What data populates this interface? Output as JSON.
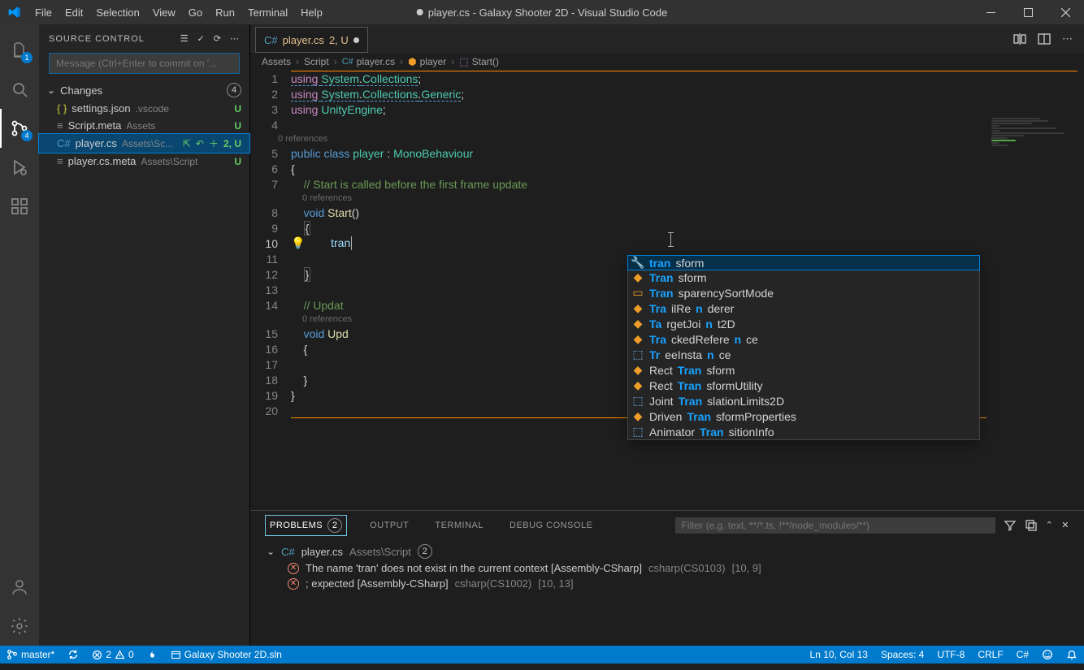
{
  "title": {
    "unsaved_dot": true,
    "filename": "player.cs",
    "project": "Galaxy Shooter 2D",
    "app": "Visual Studio Code"
  },
  "menu": [
    "File",
    "Edit",
    "Selection",
    "View",
    "Go",
    "Run",
    "Terminal",
    "Help"
  ],
  "activity_badges": {
    "explorer": "1",
    "scm": "4"
  },
  "source_control": {
    "title": "SOURCE CONTROL",
    "message_placeholder": "Message (Ctrl+Enter to commit on '...",
    "section": "Changes",
    "change_count": "4",
    "files": [
      {
        "name": "settings.json",
        "path": ".vscode",
        "status": "U",
        "icon": "json"
      },
      {
        "name": "Script.meta",
        "path": "Assets",
        "status": "U",
        "icon": "meta"
      },
      {
        "name": "player.cs",
        "path": "Assets\\Sc...",
        "status": "2, U",
        "icon": "cs",
        "selected": true,
        "row_actions": true
      },
      {
        "name": "player.cs.meta",
        "path": "Assets\\Script",
        "status": "U",
        "icon": "meta"
      }
    ]
  },
  "tab": {
    "filename": "player.cs",
    "suffix": "2, U",
    "dirty": true
  },
  "breadcrumb": [
    "Assets",
    "Script",
    "player.cs",
    "player",
    "Start()"
  ],
  "code": {
    "lines": [
      {
        "n": "1",
        "seg": [
          [
            "k-using dashed",
            "using "
          ],
          [
            "k-ns dashed",
            "System"
          ],
          [
            "dot dashed",
            "."
          ],
          [
            "k-ns dashed",
            "Collections"
          ],
          [
            "txt",
            ";"
          ]
        ]
      },
      {
        "n": "2",
        "seg": [
          [
            "k-using dashed",
            "using "
          ],
          [
            "k-ns dashed",
            "System"
          ],
          [
            "dot dashed",
            "."
          ],
          [
            "k-ns dashed",
            "Collections"
          ],
          [
            "dot dashed",
            "."
          ],
          [
            "k-ns dashed",
            "Generic"
          ],
          [
            "txt",
            ";"
          ]
        ]
      },
      {
        "n": "3",
        "seg": [
          [
            "k-using",
            "using "
          ],
          [
            "k-ns",
            "UnityEngine"
          ],
          [
            "txt",
            ";"
          ]
        ]
      },
      {
        "n": "4",
        "seg": []
      },
      {
        "ref": "0 references",
        "indent": 1
      },
      {
        "n": "5",
        "seg": [
          [
            "k-blue",
            "public "
          ],
          [
            "k-blue",
            "class "
          ],
          [
            "k-cls",
            "player"
          ],
          [
            "txt",
            " : "
          ],
          [
            "k-cls",
            "MonoBehaviour"
          ]
        ]
      },
      {
        "n": "6",
        "seg": [
          [
            "txt",
            "{"
          ]
        ]
      },
      {
        "n": "7",
        "seg": [
          [
            "txt",
            "    "
          ],
          [
            "cmt",
            "// Start is called before the first frame update"
          ]
        ]
      },
      {
        "ref": "0 references",
        "indent": 2
      },
      {
        "n": "8",
        "seg": [
          [
            "txt",
            "    "
          ],
          [
            "k-type",
            "void "
          ],
          [
            "k-fn",
            "Start"
          ],
          [
            "txt",
            "()"
          ]
        ]
      },
      {
        "n": "9",
        "seg": [
          [
            "txt",
            "    "
          ],
          [
            "txt box",
            "{"
          ]
        ]
      },
      {
        "n": "10",
        "active": true,
        "bulb": true,
        "seg": [
          [
            "txt",
            "        "
          ],
          [
            "caret-txt",
            "tran"
          ]
        ],
        "caret": true
      },
      {
        "n": "11",
        "seg": []
      },
      {
        "n": "12",
        "seg": [
          [
            "txt",
            "    "
          ],
          [
            "txt box",
            "}"
          ]
        ]
      },
      {
        "n": "13",
        "seg": []
      },
      {
        "n": "14",
        "seg": [
          [
            "txt",
            "    "
          ],
          [
            "cmt",
            "// Updat"
          ]
        ]
      },
      {
        "ref": "0 references",
        "indent": 2,
        "cut": true
      },
      {
        "n": "15",
        "seg": [
          [
            "txt",
            "    "
          ],
          [
            "k-type",
            "void "
          ],
          [
            "k-fn",
            "Upd"
          ]
        ]
      },
      {
        "n": "16",
        "seg": [
          [
            "txt",
            "    {"
          ]
        ]
      },
      {
        "n": "17",
        "seg": []
      },
      {
        "n": "18",
        "seg": [
          [
            "txt",
            "    }"
          ]
        ]
      },
      {
        "n": "19",
        "seg": [
          [
            "txt",
            "}"
          ]
        ]
      },
      {
        "n": "20",
        "seg": []
      }
    ]
  },
  "suggest": [
    {
      "icon": "wrench",
      "pre": "tran",
      "rest": "sform",
      "sel": true
    },
    {
      "icon": "class",
      "pre": "Tran",
      "rest": "sform"
    },
    {
      "icon": "enum",
      "pre": "Tran",
      "rest": "sparencySortMode"
    },
    {
      "icon": "class",
      "pre": "Tra",
      "mid": "ilRe",
      "match2": "n",
      "rest": "derer"
    },
    {
      "icon": "class",
      "pre": "Ta",
      "mid": "rgetJoi",
      "match2": "n",
      "rest": "t2D"
    },
    {
      "icon": "class",
      "pre": "Tra",
      "mid": "ckedRefere",
      "match2": "n",
      "rest": "ce"
    },
    {
      "icon": "struct",
      "pre": "Tr",
      "mid": "eeInsta",
      "match2": "n",
      "rest": "ce"
    },
    {
      "icon": "class",
      "pre2": "Rect",
      "pre": "Tran",
      "rest": "sform"
    },
    {
      "icon": "class",
      "pre2": "Rect",
      "pre": "Tran",
      "rest": "sformUtility"
    },
    {
      "icon": "struct",
      "pre2": "Joint",
      "pre": "Tran",
      "rest": "slationLimits2D"
    },
    {
      "icon": "class",
      "pre2": "Driven",
      "pre": "Tran",
      "rest": "sformProperties"
    },
    {
      "icon": "struct",
      "pre2": "Animator",
      "pre": "Tran",
      "rest": "sitionInfo"
    }
  ],
  "problems": {
    "tabs": [
      "PROBLEMS",
      "OUTPUT",
      "TERMINAL",
      "DEBUG CONSOLE"
    ],
    "count": "2",
    "filter_placeholder": "Filter (e.g. text, **/*.ts, !**/node_modules/**)",
    "file": {
      "name": "player.cs",
      "path": "Assets\\Script",
      "count": "2"
    },
    "items": [
      {
        "msg": "The name 'tran' does not exist in the current context [Assembly-CSharp]",
        "code": "csharp(CS0103)",
        "loc": "[10, 9]"
      },
      {
        "msg": "; expected [Assembly-CSharp]",
        "code": "csharp(CS1002)",
        "loc": "[10, 13]"
      }
    ]
  },
  "status": {
    "branch": "master*",
    "sync": "",
    "errors": "2",
    "warnings": "0",
    "solution": "Galaxy Shooter 2D.sln",
    "cursor": "Ln 10, Col 13",
    "spaces": "Spaces: 4",
    "encoding": "UTF-8",
    "eol": "CRLF",
    "lang": "C#",
    "feedback": "",
    "bell": ""
  }
}
